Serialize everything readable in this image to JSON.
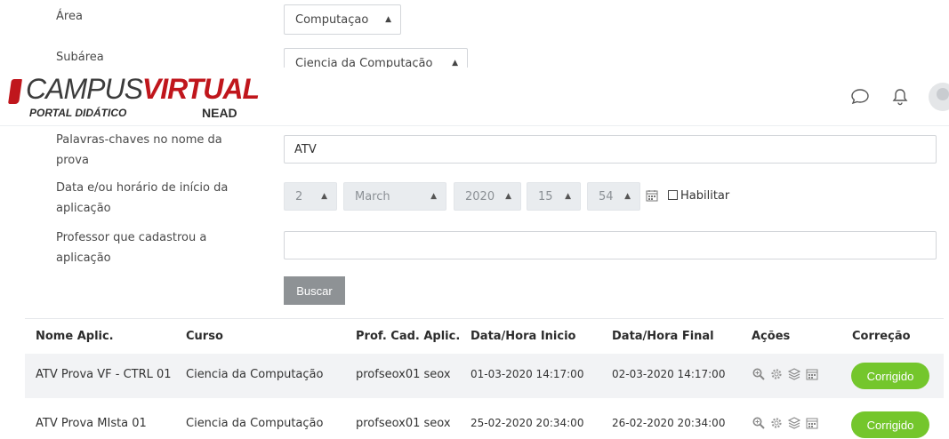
{
  "form": {
    "area": {
      "label": "Área",
      "value": "Computaçao"
    },
    "subarea": {
      "label": "Subárea",
      "value": "Ciencia da Computação"
    },
    "keywords": {
      "label_line1": "Palavras-chaves no nome da",
      "label_line2": "prova",
      "value": "ATV"
    },
    "start": {
      "label_line1": "Data e/ou horário de início da",
      "label_line2": "aplicação",
      "day": "2",
      "month": "March",
      "year": "2020",
      "hour": "15",
      "minute": "54",
      "enable_label": "Habilitar"
    },
    "teacher": {
      "label_line1": "Professor que cadastrou a",
      "label_line2": "aplicação",
      "value": ""
    },
    "search_button": "Buscar"
  },
  "header": {
    "logo_campus": "CAMPUS",
    "logo_virtual": "VIRTUAL",
    "logo_portal": "PORTAL DIDÁTICO",
    "logo_nead": "NEAD"
  },
  "table": {
    "columns": [
      "Nome Aplic.",
      "Curso",
      "Prof. Cad. Aplic.",
      "Data/Hora Inicio",
      "Data/Hora Final",
      "Ações",
      "Correção"
    ],
    "rows": [
      {
        "name": "ATV Prova VF - CTRL 01",
        "course": "Ciencia da Computação",
        "prof": "profseox01 seox",
        "start": "01-03-2020 14:17:00",
        "end": "02-03-2020 14:17:00",
        "status": "Corrigido"
      },
      {
        "name": "ATV Prova MIsta 01",
        "course": "Ciencia da Computação",
        "prof": "profseox01 seox",
        "start": "25-02-2020 20:34:00",
        "end": "26-02-2020 20:34:00",
        "status": "Corrigido"
      }
    ]
  },
  "icons": {
    "chat": "chat-bubble-icon",
    "notifications": "bell-icon",
    "calendar": "calendar-icon",
    "actions": [
      "magnifier-icon",
      "gear-icon",
      "layers-icon",
      "calendar-icon"
    ]
  },
  "colors": {
    "brand_red": "#c0161c",
    "status_green": "#74c62c",
    "button_gray": "#8e9295"
  }
}
